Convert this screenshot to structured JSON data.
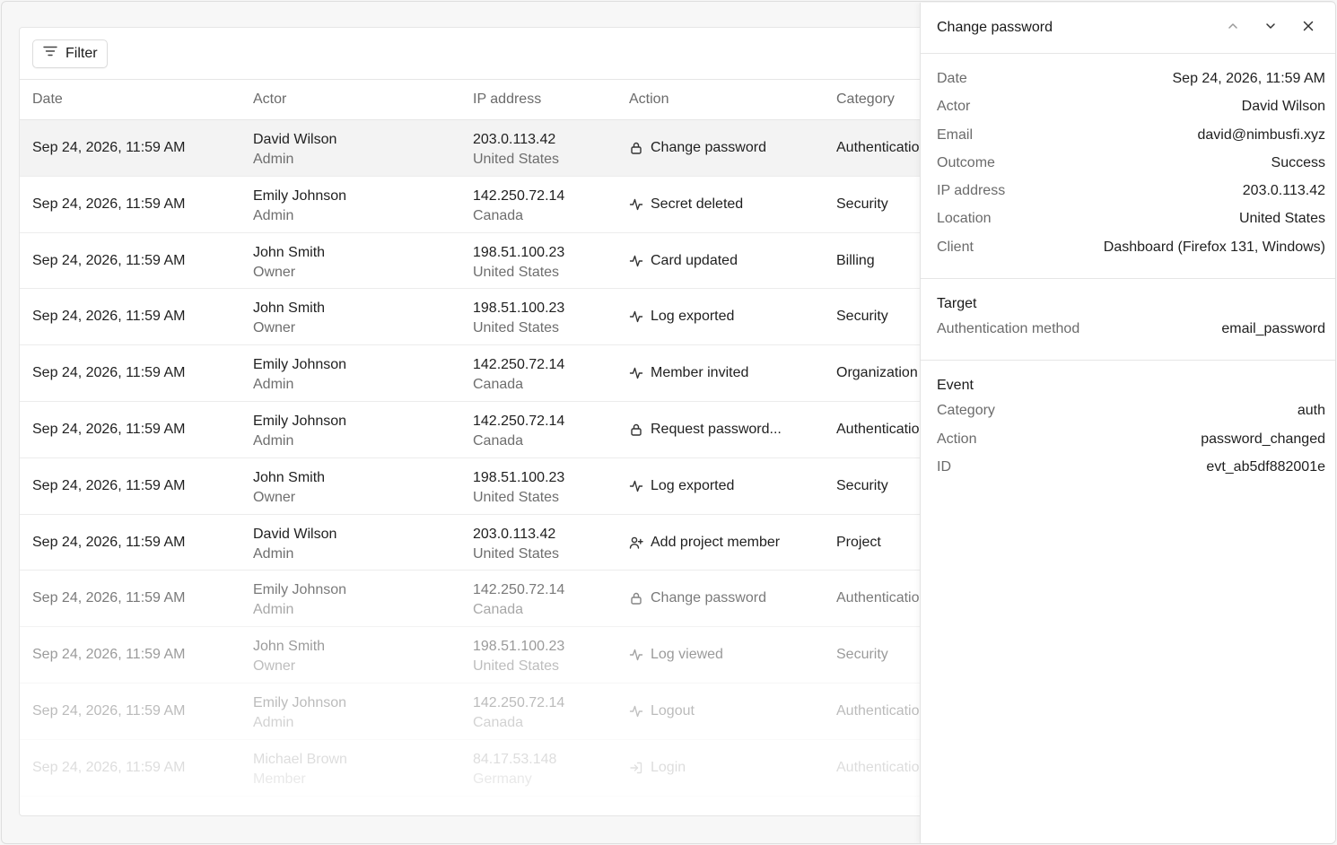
{
  "toolbar": {
    "filter_label": "Filter"
  },
  "table": {
    "headers": {
      "date": "Date",
      "actor": "Actor",
      "ip": "IP address",
      "action": "Action",
      "category": "Category"
    },
    "rows": [
      {
        "date": "Sep 24, 2026, 11:59 AM",
        "actor": "David Wilson",
        "role": "Admin",
        "ip": "203.0.113.42",
        "country": "United States",
        "icon": "lock-icon",
        "action": "Change password",
        "category": "Authentication"
      },
      {
        "date": "Sep 24, 2026, 11:59 AM",
        "actor": "Emily Johnson",
        "role": "Admin",
        "ip": "142.250.72.14",
        "country": "Canada",
        "icon": "activity-icon",
        "action": "Secret deleted",
        "category": "Security"
      },
      {
        "date": "Sep 24, 2026, 11:59 AM",
        "actor": "John Smith",
        "role": "Owner",
        "ip": "198.51.100.23",
        "country": "United States",
        "icon": "activity-icon",
        "action": "Card updated",
        "category": "Billing"
      },
      {
        "date": "Sep 24, 2026, 11:59 AM",
        "actor": "John Smith",
        "role": "Owner",
        "ip": "198.51.100.23",
        "country": "United States",
        "icon": "activity-icon",
        "action": "Log exported",
        "category": "Security"
      },
      {
        "date": "Sep 24, 2026, 11:59 AM",
        "actor": "Emily Johnson",
        "role": "Admin",
        "ip": "142.250.72.14",
        "country": "Canada",
        "icon": "activity-icon",
        "action": "Member invited",
        "category": "Organization"
      },
      {
        "date": "Sep 24, 2026, 11:59 AM",
        "actor": "Emily Johnson",
        "role": "Admin",
        "ip": "142.250.72.14",
        "country": "Canada",
        "icon": "lock-icon",
        "action": "Request password...",
        "category": "Authentication"
      },
      {
        "date": "Sep 24, 2026, 11:59 AM",
        "actor": "John Smith",
        "role": "Owner",
        "ip": "198.51.100.23",
        "country": "United States",
        "icon": "activity-icon",
        "action": "Log exported",
        "category": "Security"
      },
      {
        "date": "Sep 24, 2026, 11:59 AM",
        "actor": "David Wilson",
        "role": "Admin",
        "ip": "203.0.113.42",
        "country": "United States",
        "icon": "user-plus-icon",
        "action": "Add project member",
        "category": "Project"
      },
      {
        "date": "Sep 24, 2026, 11:59 AM",
        "actor": "Emily Johnson",
        "role": "Admin",
        "ip": "142.250.72.14",
        "country": "Canada",
        "icon": "lock-icon",
        "action": "Change password",
        "category": "Authentication"
      },
      {
        "date": "Sep 24, 2026, 11:59 AM",
        "actor": "John Smith",
        "role": "Owner",
        "ip": "198.51.100.23",
        "country": "United States",
        "icon": "activity-icon",
        "action": "Log viewed",
        "category": "Security"
      },
      {
        "date": "Sep 24, 2026, 11:59 AM",
        "actor": "Emily Johnson",
        "role": "Admin",
        "ip": "142.250.72.14",
        "country": "Canada",
        "icon": "activity-icon",
        "action": "Logout",
        "category": "Authentication"
      },
      {
        "date": "Sep 24, 2026, 11:59 AM",
        "actor": "Michael Brown",
        "role": "Member",
        "ip": "84.17.53.148",
        "country": "Germany",
        "icon": "login-icon",
        "action": "Login",
        "category": "Authentication"
      }
    ]
  },
  "panel": {
    "title": "Change password",
    "details": [
      {
        "k": "Date",
        "v": "Sep 24, 2026, 11:59 AM"
      },
      {
        "k": "Actor",
        "v": "David Wilson"
      },
      {
        "k": "Email",
        "v": "david@nimbusfi.xyz"
      },
      {
        "k": "Outcome",
        "v": "Success"
      },
      {
        "k": "IP address",
        "v": "203.0.113.42"
      },
      {
        "k": "Location",
        "v": "United States"
      },
      {
        "k": "Client",
        "v": "Dashboard (Firefox 131, Windows)"
      }
    ],
    "target": {
      "title": "Target",
      "items": [
        {
          "k": "Authentication method",
          "v": "email_password"
        }
      ]
    },
    "event": {
      "title": "Event",
      "items": [
        {
          "k": "Category",
          "v": "auth"
        },
        {
          "k": "Action",
          "v": "password_changed"
        },
        {
          "k": "ID",
          "v": "evt_ab5df882001e"
        }
      ]
    }
  },
  "colors": {
    "selected_row": "#f3f3f3",
    "border": "#e6e6e6",
    "muted_text": "#6b6b6b"
  }
}
